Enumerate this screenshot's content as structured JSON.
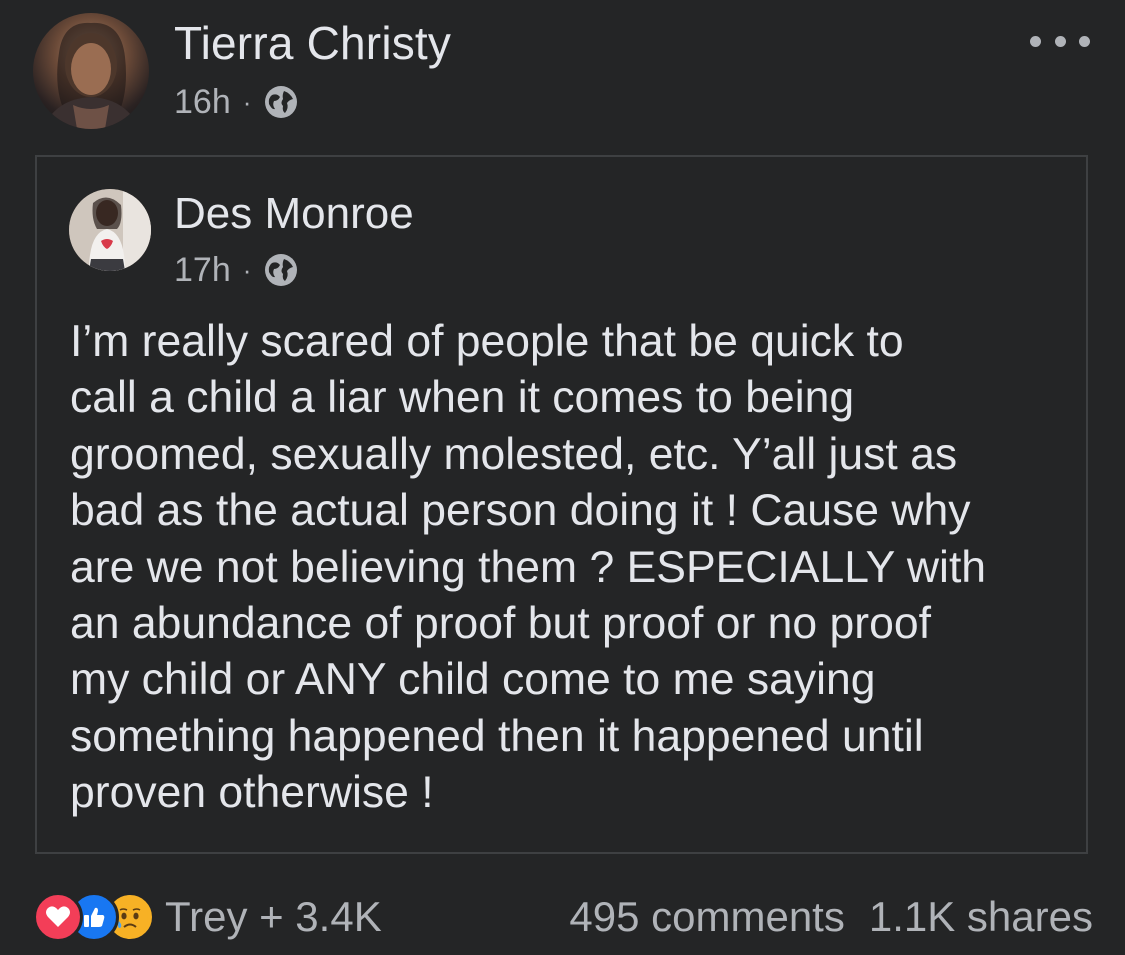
{
  "post": {
    "author_name": "Tierra Christy",
    "time": "16h",
    "separator": "·",
    "audience_icon": "globe-icon",
    "more_icon": "more-options-icon"
  },
  "shared_post": {
    "author_name": "Des Monroe",
    "time": "17h",
    "separator": "·",
    "audience_icon": "globe-icon",
    "text": "I’m really scared of people that be quick to\ncall a child a liar when it comes to being\ngroomed, sexually molested, etc. Y’all just as\nbad as the actual person doing it ! Cause why\nare we not believing them ? ESPECIALLY with\nan abundance of proof but proof or no proof\nmy child or ANY child come to me saying\nsomething happened then it happened until\nproven otherwise !"
  },
  "footer": {
    "reactions": [
      "love-reaction-icon",
      "like-reaction-icon",
      "sad-reaction-icon"
    ],
    "reaction_summary": "Trey + 3.4K",
    "comments": "495 comments",
    "shares": "1.1K shares"
  },
  "colors": {
    "background": "#242526",
    "primary_text": "#e4e6eb",
    "secondary_text": "#b0b3b8",
    "card_border": "#3e4042",
    "love": "#f33e58",
    "like": "#1877f2",
    "sad": "#f7b125"
  }
}
